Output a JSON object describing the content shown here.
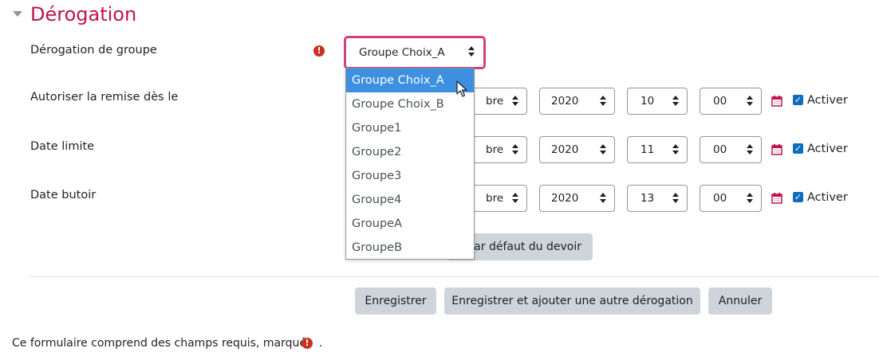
{
  "section": {
    "title": "Dérogation"
  },
  "rows": {
    "group": {
      "label": "Dérogation de groupe",
      "selected": "Groupe Choix_A",
      "required_icon": "exclamation-circle-icon"
    },
    "allow_from": {
      "label": "Autoriser la remise dès le",
      "month_partial": "bre",
      "year": "2020",
      "day": "10",
      "minute": "00",
      "enable_label": "Activer",
      "enabled": true
    },
    "due": {
      "label": "Date limite",
      "month_partial": "bre",
      "year": "2020",
      "day": "11",
      "minute": "00",
      "enable_label": "Activer",
      "enabled": true
    },
    "cutoff": {
      "label": "Date butoir",
      "month_partial": "bre",
      "year": "2020",
      "day": "13",
      "minute": "00",
      "enable_label": "Activer",
      "enabled": true
    }
  },
  "dropdown": {
    "options": [
      "Groupe Choix_A",
      "Groupe Choix_B",
      "Groupe1",
      "Groupe2",
      "Groupe3",
      "Groupe4",
      "GroupeA",
      "GroupeB"
    ],
    "highlighted_index": 0
  },
  "revert_button_partial": "par défaut du devoir",
  "actions": {
    "save": "Enregistrer",
    "save_add": "Enregistrer et ajouter une autre dérogation",
    "cancel": "Annuler"
  },
  "footer": {
    "note": "Ce formulaire comprend des champs requis, marqués",
    "period": "."
  },
  "colors": {
    "accent": "#c1124f",
    "focus": "#d0427d",
    "selected": "#3d8fe0",
    "checkbox": "#0f6cbf",
    "required": "#ca3120",
    "button": "#ced4da"
  },
  "icons": {
    "calendar": "calendar-icon",
    "checkbox": "checkbox-checked-icon"
  }
}
